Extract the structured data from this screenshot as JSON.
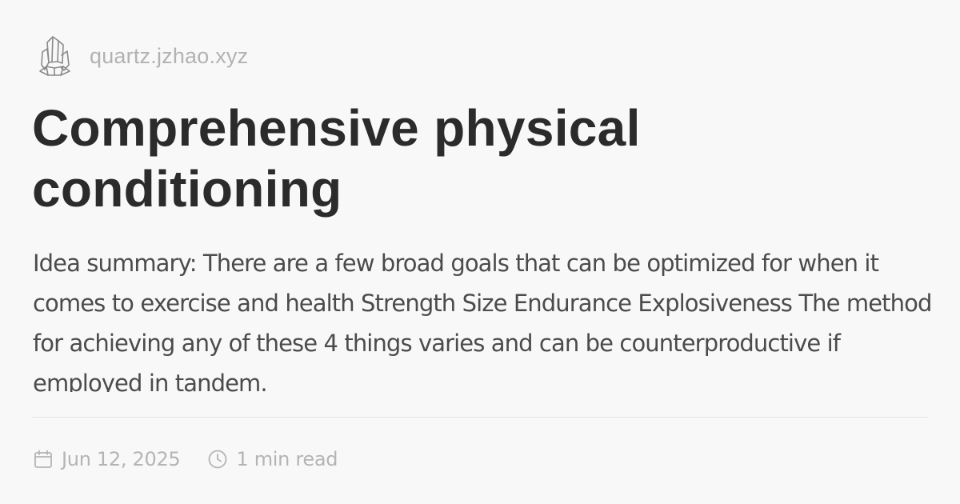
{
  "site": {
    "logo_icon": "crystal-quartz-icon",
    "name": "quartz.jzhao.xyz"
  },
  "article": {
    "title": "Comprehensive physical conditioning",
    "summary": "Idea summary: There are a few broad goals that can be optimized for when it comes to exercise and health Strength Size Endurance Explosiveness The method for achieving any of these 4 things varies and can be counterproductive if employed in tandem.",
    "date": "Jun 12, 2025",
    "reading_time": "1 min read"
  },
  "icons": {
    "date": "calendar-icon",
    "reading_time": "clock-icon"
  },
  "colors": {
    "background": "#f8f8f9",
    "title": "#2b2b2b",
    "body_text": "#4b4b4b",
    "muted": "#b2b2b2",
    "divider": "#e4e4e6"
  }
}
